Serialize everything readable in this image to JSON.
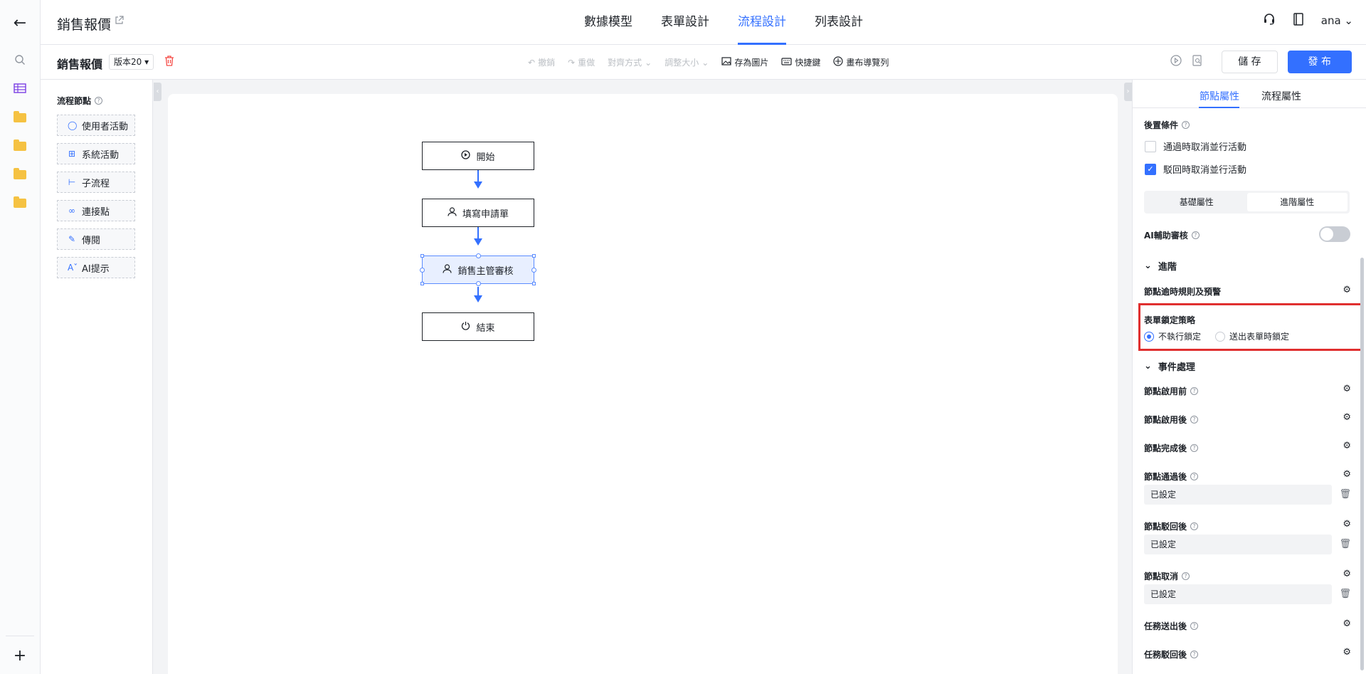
{
  "header": {
    "title": "銷售報價",
    "tabs": [
      "數據模型",
      "表單設計",
      "流程設計",
      "列表設計"
    ],
    "user": "ana"
  },
  "toolbar": {
    "page_title": "銷售報價",
    "version": "版本20",
    "undo": "撤銷",
    "redo": "重做",
    "align": "對齊方式",
    "resize": "調整大小",
    "save_image": "存為圖片",
    "shortcuts": "快捷鍵",
    "canvas_nav": "畫布導覽列",
    "save": "儲 存",
    "publish": "發 布"
  },
  "palette": {
    "title": "流程節點",
    "items": [
      "使用者活動",
      "系統活動",
      "子流程",
      "連接點",
      "傳閱",
      "AI提示"
    ]
  },
  "flow": {
    "nodes": [
      "開始",
      "填寫申請單",
      "銷售主管審核",
      "結束"
    ]
  },
  "panel": {
    "tabs": [
      "節點屬性",
      "流程屬性"
    ],
    "post_condition": "後置條件",
    "cb1": "通過時取消並行活動",
    "cb2": "駁回時取消並行活動",
    "seg_basic": "基礎屬性",
    "seg_advanced": "進階屬性",
    "ai_review": "AI輔助審核",
    "advanced": "進階",
    "timeout": "節點逾時規則及預警",
    "lock_policy": "表單鎖定策略",
    "radio1": "不執行鎖定",
    "radio2": "送出表單時鎖定",
    "events": "事件處理",
    "ev": [
      "節點啟用前",
      "節點啟用後",
      "節點完成後",
      "節點通過後",
      "節點駁回後",
      "節點取消",
      "任務送出後",
      "任務駁回後"
    ],
    "configured": "已設定"
  }
}
